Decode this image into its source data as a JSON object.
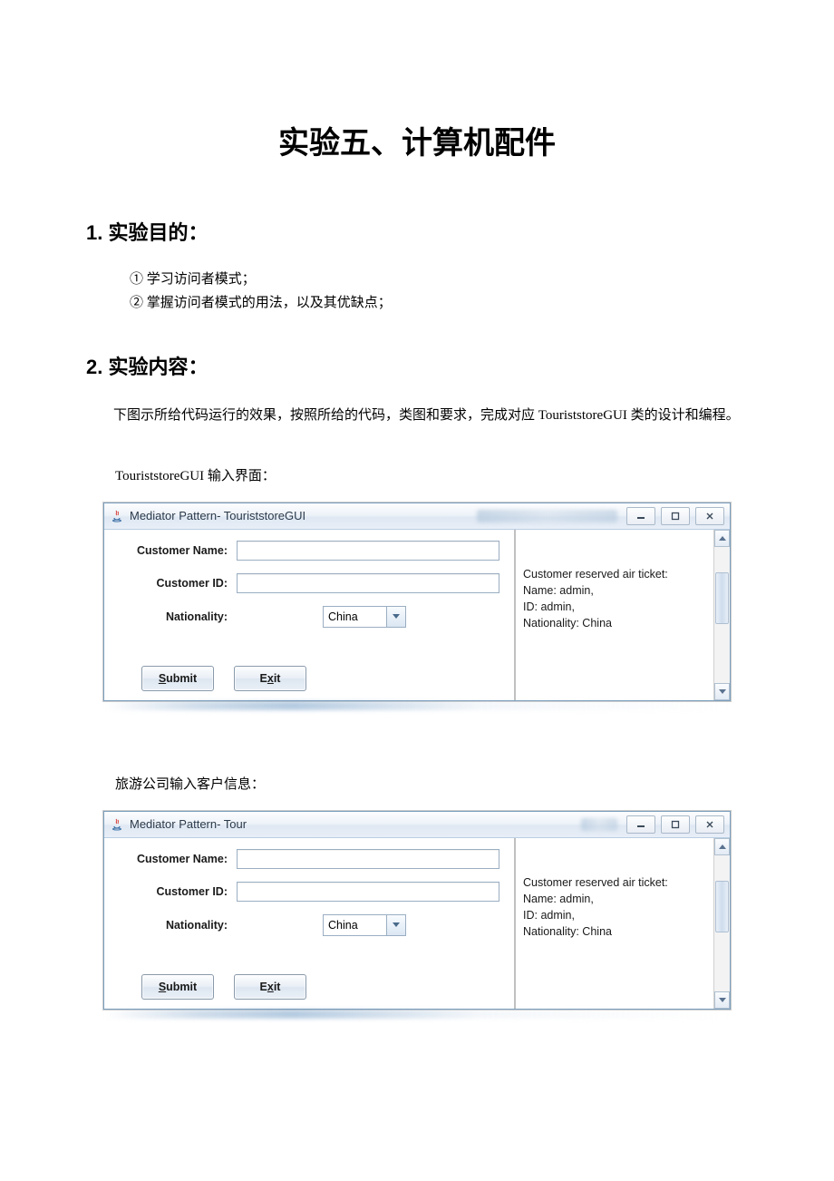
{
  "title": "实验五、计算机配件",
  "section1": {
    "heading": "1. 实验目的：",
    "items": [
      "① 学习访问者模式；",
      "② 掌握访问者模式的用法，以及其优缺点；"
    ]
  },
  "section2": {
    "heading": "2. 实验内容：",
    "paragraph": "下图示所给代码运行的效果，按照所给的代码，类图和要求，完成对应 TouriststoreGUI 类的设计和编程。",
    "caption1": "TouriststoreGUI 输入界面：",
    "caption2": "旅游公司输入客户信息："
  },
  "app1": {
    "windowTitle": "Mediator Pattern- TouriststoreGUI",
    "labels": {
      "customerName": "Customer Name:",
      "customerId": "Customer ID:",
      "nationality": "Nationality:"
    },
    "combo": {
      "selected": "China"
    },
    "buttons": {
      "submit": "Submit",
      "exit": "Exit"
    },
    "rightText": {
      "line1": "Customer reserved air ticket:",
      "line2": "Name: admin,",
      "line3": "ID: admin,",
      "line4": "Nationality: China"
    }
  },
  "app2": {
    "windowTitle": "Mediator Pattern- Tour",
    "labels": {
      "customerName": "Customer Name:",
      "customerId": "Customer ID:",
      "nationality": "Nationality:"
    },
    "combo": {
      "selected": "China"
    },
    "buttons": {
      "submit": "Submit",
      "exit": "Exit"
    },
    "rightText": {
      "line1": "Customer reserved air ticket:",
      "line2": "Name: admin,",
      "line3": "ID: admin,",
      "line4": "Nationality: China"
    }
  }
}
